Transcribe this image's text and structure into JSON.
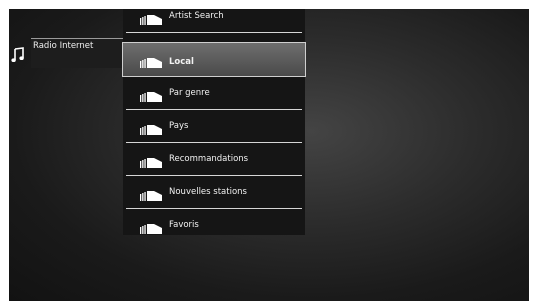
{
  "sidebar": {
    "icon": "music-note-icon",
    "source_label": "Radio Internet"
  },
  "menu": {
    "selected_index": 1,
    "item_icon": "internet-radio-icon",
    "items": [
      {
        "label": "Artist Search"
      },
      {
        "label": "Local"
      },
      {
        "label": "Par genre"
      },
      {
        "label": "Pays"
      },
      {
        "label": "Recommandations"
      },
      {
        "label": "Nouvelles stations"
      },
      {
        "label": "Favoris"
      }
    ]
  },
  "colors": {
    "background": "#1a1a1a",
    "panel": "#151515",
    "selected": "#5c5c5c",
    "text": "#f2f2f2"
  }
}
